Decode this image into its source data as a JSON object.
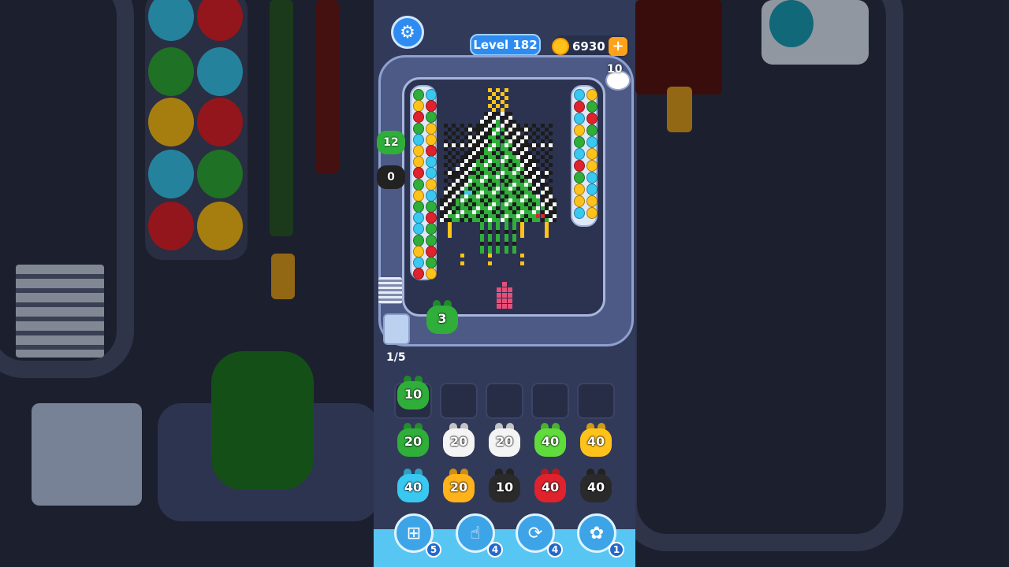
{
  "header": {
    "level_label": "Level 182",
    "coins": "6930",
    "coin_add_symbol": "+",
    "settings_icon": "gear-icon"
  },
  "board": {
    "hand_pickup_count": "10",
    "side_shooters": [
      {
        "count": "12",
        "color": "#2fae3a"
      },
      {
        "count": "0",
        "color": "#222222"
      }
    ],
    "track_shooter": {
      "count": "3",
      "color": "#2fae3a"
    },
    "palette": {
      "green": "#2fae3a",
      "black": "#1c1c1c",
      "white": "#f4f4f4",
      "yellow": "#ffc21a",
      "red": "#e0222c",
      "cyan": "#39c8f0",
      "pink": "#e4507a"
    }
  },
  "queue": {
    "progress": "1/5",
    "active_slot": {
      "count": "10",
      "color": "#2fae3a"
    },
    "empty_slots": 4
  },
  "reserve": {
    "row1": [
      {
        "count": "20",
        "color": "#2fae3a"
      },
      {
        "count": "20",
        "color": "#f4f4f4"
      },
      {
        "count": "20",
        "color": "#f4f4f4"
      },
      {
        "count": "40",
        "color": "#5fdc3c"
      },
      {
        "count": "40",
        "color": "#ffc21a"
      }
    ],
    "row2": [
      {
        "count": "40",
        "color": "#39c8f0"
      },
      {
        "count": "20",
        "color": "#ffb21a"
      },
      {
        "count": "10",
        "color": "#2a2a2a"
      },
      {
        "count": "40",
        "color": "#e0222c"
      },
      {
        "count": "40",
        "color": "#2a2a2a"
      }
    ]
  },
  "toolbar": {
    "tools": [
      {
        "name": "add-slot",
        "icon": "add-slot-icon",
        "count": "5"
      },
      {
        "name": "hand-pick",
        "icon": "hand-icon",
        "count": "4"
      },
      {
        "name": "shuffle",
        "icon": "shuffle-icon",
        "count": "4"
      },
      {
        "name": "magnet-bunny",
        "icon": "bunny-icon",
        "count": "1"
      }
    ]
  }
}
